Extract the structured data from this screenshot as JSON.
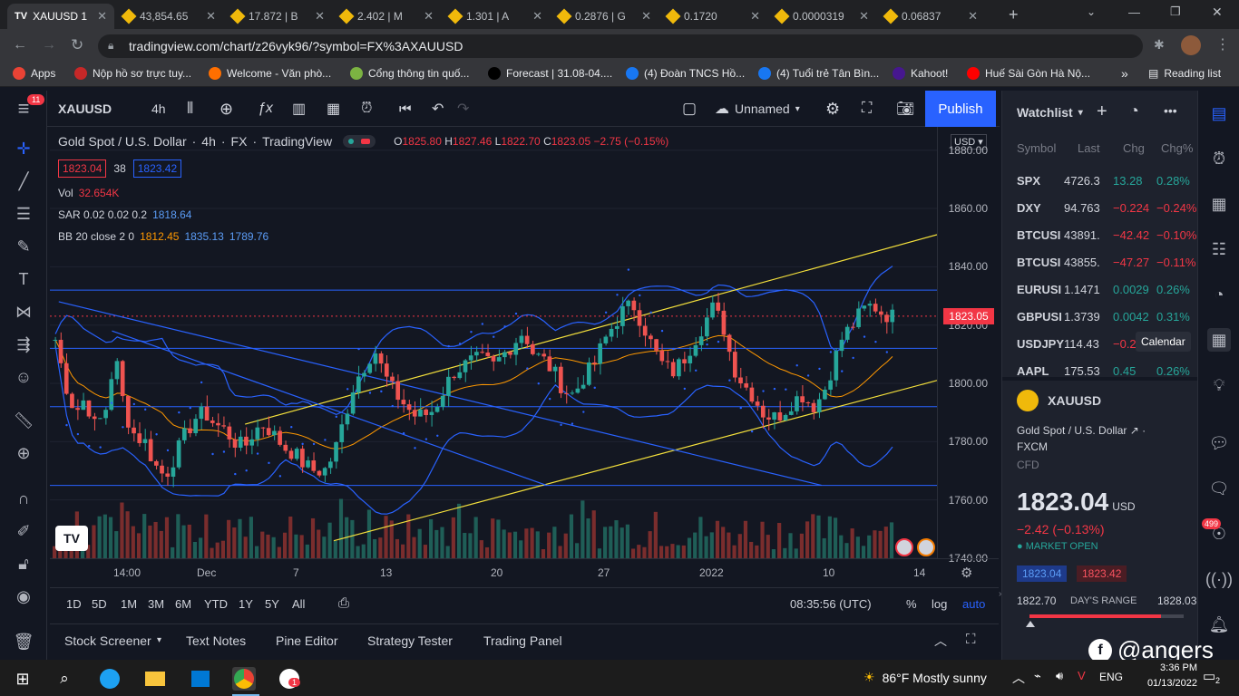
{
  "browser": {
    "tabs": [
      {
        "label": "XAUUSD 1",
        "icon": "tradingview-icon",
        "active": true
      },
      {
        "label": "43,854.65",
        "icon": "binance-icon"
      },
      {
        "label": "17.872 | B",
        "icon": "binance-icon"
      },
      {
        "label": "2.402 | M",
        "icon": "binance-icon"
      },
      {
        "label": "1.301 | A",
        "icon": "binance-icon"
      },
      {
        "label": "0.2876 | G",
        "icon": "binance-icon"
      },
      {
        "label": "0.1720",
        "icon": "binance-icon"
      },
      {
        "label": "0.0000319",
        "icon": "binance-icon"
      },
      {
        "label": "0.06837",
        "icon": "binance-icon"
      }
    ],
    "new_tab": "+",
    "url": "tradingview.com/chart/z26vyk96/?symbol=FX%3AXAUUSD",
    "bookmarks": [
      {
        "label": "Apps",
        "color": "#ea4335"
      },
      {
        "label": "Nộp hồ sơ trực tuy...",
        "color": "#c62828"
      },
      {
        "label": "Welcome - Văn phò...",
        "color": "#ff6f00"
      },
      {
        "label": "Cổng thông tin quố...",
        "color": "#7cb342"
      },
      {
        "label": "Forecast | 31.08-04....",
        "color": "#000000"
      },
      {
        "label": "(4) Đoàn TNCS Hồ...",
        "color": "#1877f2"
      },
      {
        "label": "(4) Tuổi trẻ Tân Bìn...",
        "color": "#1877f2"
      },
      {
        "label": "Kahoot!",
        "color": "#46178f"
      },
      {
        "label": "Huế Sài Gòn Hà Nộ...",
        "color": "#ff0000"
      }
    ],
    "more_bookmarks": "»",
    "reading_list": "Reading list"
  },
  "toolbar": {
    "notification_count": "11",
    "symbol": "XAUUSD",
    "interval": "4h",
    "layout_name": "Unnamed",
    "publish": "Publish"
  },
  "legend": {
    "title": "Gold Spot / U.S. Dollar",
    "interval": "4h",
    "exchange": "FX",
    "source": "TradingView",
    "ohlc": {
      "o_label": "O",
      "o": "1825.80",
      "h_label": "H",
      "h": "1827.46",
      "l_label": "L",
      "l": "1822.70",
      "c_label": "C",
      "c": "1823.05",
      "change": "−2.75 (−0.15%)"
    },
    "bid": "1823.04",
    "spread": "38",
    "ask": "1823.42",
    "vol_label": "Vol",
    "vol": "32.654K",
    "sar_label": "SAR 0.02 0.02 0.2",
    "sar": "1818.64",
    "bb_label": "BB 20 close 2 0",
    "bb_mid": "1812.45",
    "bb_up": "1835.13",
    "bb_low": "1789.76"
  },
  "price_axis": {
    "currency": "USD",
    "labels": [
      "1880.00",
      "1860.00",
      "1840.00",
      "1820.00",
      "1800.00",
      "1780.00",
      "1760.00",
      "1740.00"
    ],
    "current": "1823.05"
  },
  "time_axis": [
    "14:00",
    "Dec",
    "7",
    "13",
    "20",
    "27",
    "2022",
    "10",
    "14"
  ],
  "range_bar": {
    "ranges": [
      "1D",
      "5D",
      "1M",
      "3M",
      "6M",
      "YTD",
      "1Y",
      "5Y",
      "All"
    ],
    "clock": "08:35:56 (UTC)",
    "percent": "%",
    "log": "log",
    "auto": "auto"
  },
  "bottom_tabs": [
    "Stock Screener",
    "Text Notes",
    "Pine Editor",
    "Strategy Tester",
    "Trading Panel"
  ],
  "watchlist": {
    "title": "Watchlist",
    "headers": {
      "symbol": "Symbol",
      "last": "Last",
      "chg": "Chg",
      "chgp": "Chg%"
    },
    "rows": [
      {
        "symbol": "SPX",
        "last": "4726.3",
        "chg": "13.28",
        "chgp": "0.28%",
        "dir": "up"
      },
      {
        "symbol": "DXY",
        "last": "94.763",
        "chg": "−0.224",
        "chgp": "−0.24%",
        "dir": "dn"
      },
      {
        "symbol": "BTCUSI",
        "last": "43891.",
        "chg": "−42.42",
        "chgp": "−0.10%",
        "dir": "dn"
      },
      {
        "symbol": "BTCUSI",
        "last": "43855.",
        "chg": "−47.27",
        "chgp": "−0.11%",
        "dir": "dn"
      },
      {
        "symbol": "EURUSI",
        "last": "1.1471",
        "chg": "0.0029",
        "chgp": "0.26%",
        "dir": "up"
      },
      {
        "symbol": "GBPUSI",
        "last": "1.3739",
        "chg": "0.0042",
        "chgp": "0.31%",
        "dir": "up"
      },
      {
        "symbol": "USDJPY",
        "last": "114.43",
        "chg": "−0.2",
        "chgp": "",
        "dir": "dn"
      },
      {
        "symbol": "AAPL",
        "last": "175.53",
        "chg": "0.45",
        "chgp": "0.26%",
        "dir": "up"
      }
    ],
    "tooltip": "Calendar"
  },
  "details": {
    "symbol": "XAUUSD",
    "name": "Gold Spot / U.S. Dollar",
    "exchange": "FXCM",
    "type": "CFD",
    "price": "1823.04",
    "currency": "USD",
    "change": "−2.42 (−0.13%)",
    "status": "MARKET OPEN",
    "bid": "1823.04",
    "ask": "1823.42",
    "day_low": "1822.70",
    "day_range_label": "DAY'S RANGE",
    "day_high": "1828.03",
    "day_range_fraction": 0.06
  },
  "right_strip": {
    "notification_badge": "499"
  },
  "watermark": "@angers",
  "taskbar": {
    "weather": "86°F  Mostly sunny",
    "lang": "ENG",
    "time": "3:36 PM",
    "date": "01/13/2022",
    "notifications": "2",
    "zalo_badge": "1"
  },
  "colors": {
    "bg": "#131722",
    "up": "#26a69a",
    "down": "#ef5350",
    "accent": "#2962ff",
    "trend_yellow": "#f5e13c",
    "level_blue": "#2962ff"
  },
  "chart_data": {
    "type": "candlestick",
    "symbol": "XAUUSD",
    "interval": "4h",
    "ylim": [
      1740,
      1888
    ],
    "x_labels": [
      "14:00",
      "Dec",
      "7",
      "13",
      "20",
      "27",
      "2022",
      "10",
      "14"
    ],
    "close_path": [
      1815,
      1800,
      1790,
      1795,
      1785,
      1790,
      1810,
      1790,
      1782,
      1780,
      1772,
      1768,
      1775,
      1782,
      1788,
      1790,
      1786,
      1784,
      1780,
      1778,
      1784,
      1786,
      1782,
      1778,
      1776,
      1772,
      1770,
      1770,
      1776,
      1788,
      1800,
      1806,
      1812,
      1803,
      1797,
      1793,
      1789,
      1789,
      1791,
      1798,
      1804,
      1806,
      1808,
      1808,
      1806,
      1810,
      1814,
      1818,
      1810,
      1808,
      1804,
      1798,
      1796,
      1802,
      1806,
      1814,
      1820,
      1825,
      1827,
      1820,
      1812,
      1806,
      1804,
      1808,
      1814,
      1820,
      1826,
      1820,
      1806,
      1800,
      1796,
      1790,
      1788,
      1790,
      1794,
      1796,
      1792,
      1796,
      1806,
      1816,
      1820,
      1825,
      1827,
      1824,
      1823
    ],
    "horizontal_levels": [
      1832,
      1812,
      1792,
      1765
    ],
    "trend_lines": [
      {
        "color": "yellow",
        "from": [
          0.22,
          1786
        ],
        "to": [
          1.0,
          1851
        ]
      },
      {
        "color": "yellow",
        "from": [
          0.32,
          1746
        ],
        "to": [
          1.0,
          1801
        ]
      },
      {
        "color": "blue",
        "from": [
          0.01,
          1828
        ],
        "to": [
          0.87,
          1765
        ]
      },
      {
        "color": "blue",
        "from": [
          0.07,
          1818
        ],
        "to": [
          0.56,
          1765
        ]
      }
    ]
  }
}
